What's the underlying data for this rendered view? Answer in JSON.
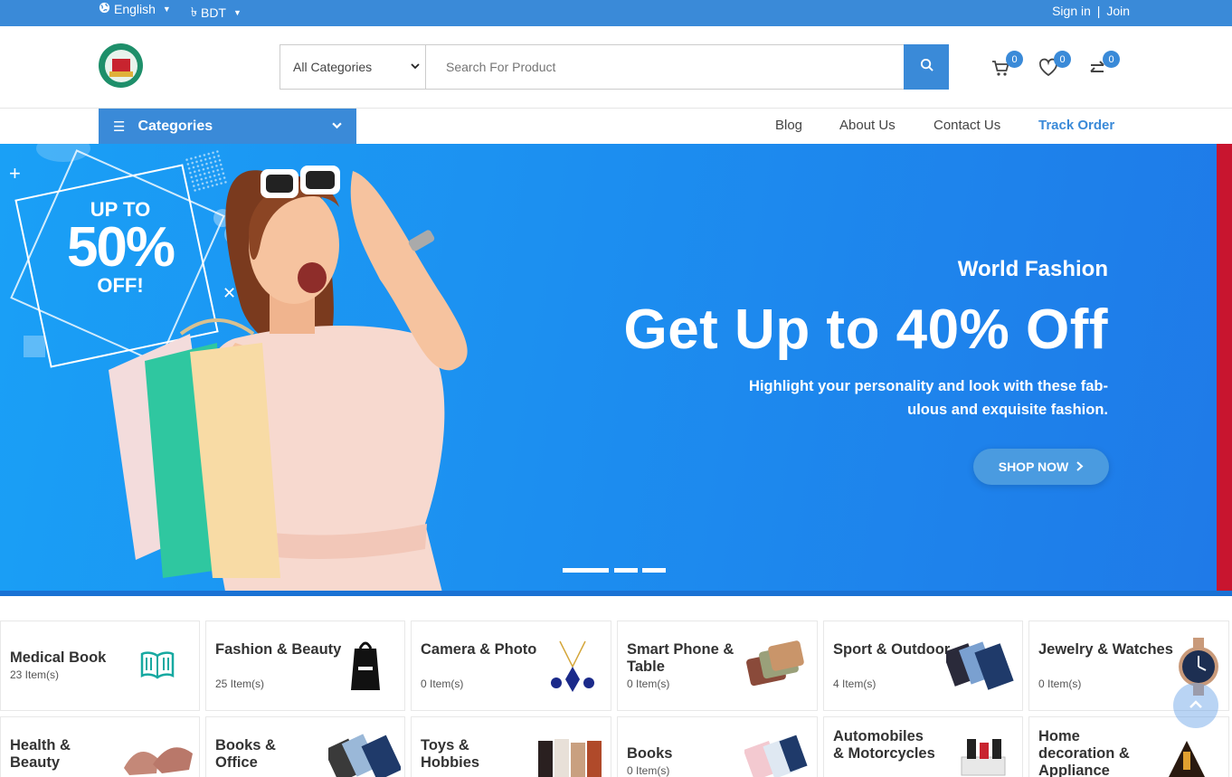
{
  "topbar": {
    "language": "English",
    "currency": "BDT",
    "sign_in": "Sign in",
    "separator": "|",
    "join": "Join"
  },
  "header": {
    "category_select": "All Categories",
    "search_placeholder": "Search For Product",
    "cart_count": "0",
    "wishlist_count": "0",
    "compare_count": "0"
  },
  "nav": {
    "categories_label": "Categories",
    "links": [
      "Blog",
      "About Us",
      "Contact Us",
      "Track Order"
    ]
  },
  "hero": {
    "badge_line1": "UP TO",
    "badge_line2": "50%",
    "badge_line3": "OFF!",
    "subtitle": "World Fashion",
    "title": "Get Up to 40% Off",
    "description": "Highlight your personality and look with these fab-ulous and exquisite fashion.",
    "cta": "SHOP NOW"
  },
  "categories": [
    {
      "name": "Medical Book",
      "count": "23 Item(s)"
    },
    {
      "name": "Fashion & Beauty",
      "count": "25 Item(s)"
    },
    {
      "name": "Camera & Photo",
      "count": "0 Item(s)"
    },
    {
      "name": "Smart Phone & Table",
      "count": "0 Item(s)"
    },
    {
      "name": "Sport & Outdoor",
      "count": "4 Item(s)"
    },
    {
      "name": "Jewelry & Watches",
      "count": "0 Item(s)"
    },
    {
      "name": "Health & Beauty",
      "count": ""
    },
    {
      "name": "Books & Office",
      "count": ""
    },
    {
      "name": "Toys & Hobbies",
      "count": ""
    },
    {
      "name": "Books",
      "count": "0 Item(s)"
    },
    {
      "name": "Automobiles & Motorcycles",
      "count": ""
    },
    {
      "name": "Home decoration & Appliance",
      "count": ""
    }
  ],
  "colors": {
    "primary": "#3a8ad8",
    "hero_bg": "#1c8ff0",
    "accent_red": "#c8152f"
  }
}
